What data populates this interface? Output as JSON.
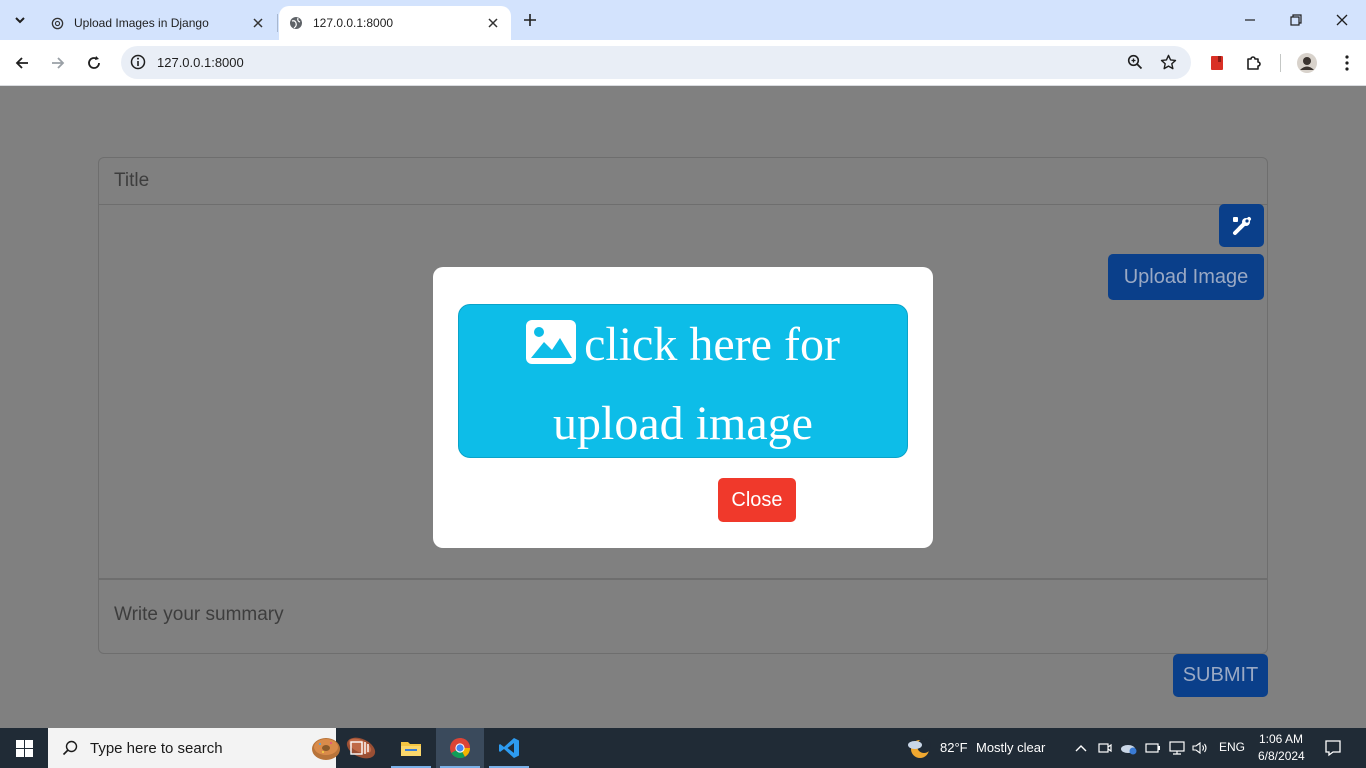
{
  "browser": {
    "tabs": [
      {
        "title": "Upload Images in Django",
        "active": false,
        "favicon": "openai-logo-icon"
      },
      {
        "title": "127.0.0.1:8000",
        "active": true,
        "favicon": "globe-icon"
      }
    ],
    "address_bar": {
      "url": "127.0.0.1:8000"
    }
  },
  "page": {
    "title_placeholder": "Title",
    "upload_button_label": "Upload Image",
    "tools_button_icon": "tools-icon",
    "summary_placeholder": "Write your summary",
    "submit_label": "SUBMIT"
  },
  "modal": {
    "dropzone_line1": "click here for",
    "dropzone_line2": "upload image",
    "dropzone_icon": "image-icon",
    "close_label": "Close"
  },
  "taskbar": {
    "search_placeholder": "Type here to search",
    "weather_temp": "82°F",
    "weather_desc": "Mostly clear",
    "language": "ENG",
    "time": "1:06 AM",
    "date": "6/8/2024"
  },
  "colors": {
    "accent_blue": "#0a3f8a",
    "dropzone_cyan": "#0dbde8",
    "close_red": "#f0392b",
    "overlay_gray": "#808080"
  }
}
